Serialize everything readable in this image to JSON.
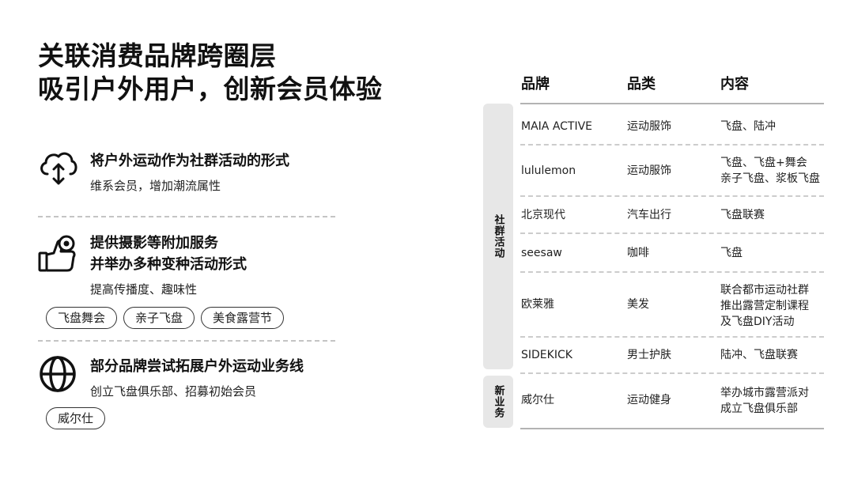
{
  "title": {
    "line1": "关联消费品牌跨圈层",
    "line2": "吸引户外用户，创新会员体验"
  },
  "features": [
    {
      "icon": "cloud-transfer-icon",
      "heading": "将户外运动作为社群活动的形式",
      "sub": "维系会员，增加潮流属性",
      "tags": []
    },
    {
      "icon": "camera-thumbs-up-icon",
      "heading": "提供摄影等附加服务",
      "heading2": "并举办多种变种活动形式",
      "sub": "提高传播度、趣味性",
      "tags": [
        "飞盘舞会",
        "亲子飞盘",
        "美食露营节"
      ]
    },
    {
      "icon": "globe-icon",
      "heading": "部分品牌尝试拓展户外运动业务线",
      "sub": "创立飞盘俱乐部、招募初始会员",
      "tags": [
        "威尔仕"
      ]
    }
  ],
  "table": {
    "headers": [
      "品牌",
      "品类",
      "内容"
    ],
    "groups": [
      {
        "label": "社群活动"
      },
      {
        "label": "新业务"
      }
    ],
    "rows": [
      {
        "brand": "MAIA ACTIVE",
        "category": "运动服饰",
        "content": [
          "飞盘、陆冲"
        ]
      },
      {
        "brand": "lululemon",
        "category": "运动服饰",
        "content": [
          "飞盘、飞盘+舞会",
          "亲子飞盘、浆板飞盘"
        ]
      },
      {
        "brand": "北京现代",
        "category": "汽车出行",
        "content": [
          "飞盘联赛"
        ]
      },
      {
        "brand": "seesaw",
        "category": "咖啡",
        "content": [
          "飞盘"
        ]
      },
      {
        "brand": "欧莱雅",
        "category": "美发",
        "content": [
          "联合都市运动社群",
          "推出露营定制课程",
          "及飞盘DIY活动"
        ]
      },
      {
        "brand": "SIDEKICK",
        "category": "男士护肤",
        "content": [
          "陆冲、飞盘联赛"
        ]
      },
      {
        "brand": "威尔仕",
        "category": "运动健身",
        "content": [
          "举办城市露营派对",
          "成立飞盘俱乐部"
        ]
      }
    ]
  }
}
